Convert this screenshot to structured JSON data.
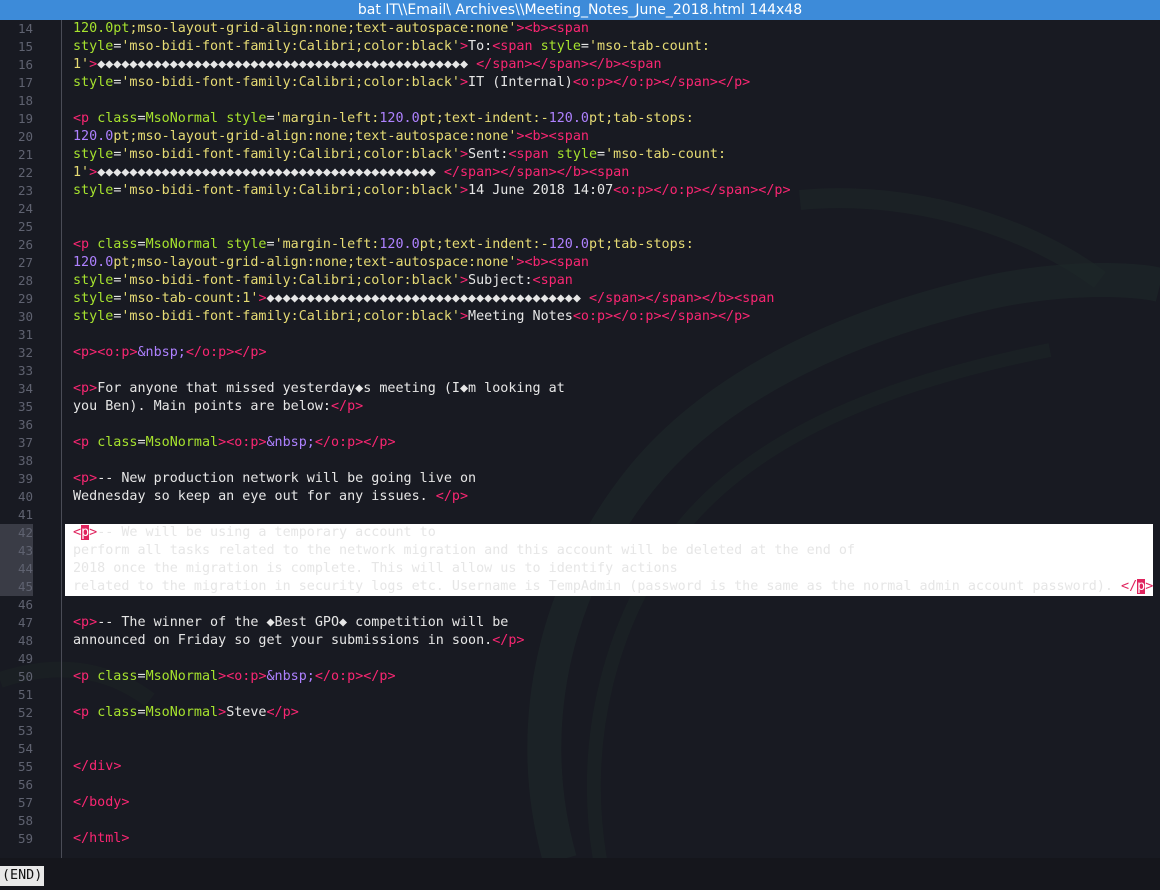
{
  "window": {
    "title": "bat IT\\\\Email\\ Archives\\\\Meeting_Notes_June_2018.html 144x48"
  },
  "colors": {
    "title_bar": "#3d8bd9",
    "background": "#181a22",
    "tag": "#f92672",
    "attribute": "#a6e22e",
    "string": "#e6db74",
    "number": "#ae81ff",
    "selection": "#ffffff"
  },
  "selected_lines": [
    42,
    43,
    44,
    45
  ],
  "lines": [
    {
      "n": "14",
      "tokens": [
        [
          "attr",
          "120.0pt"
        ],
        [
          "str",
          ";mso-layout-grid-align:none;text-autospace:none'"
        ],
        [
          "tag",
          ">"
        ],
        [
          "tag",
          "<b"
        ],
        [
          "tag",
          ">"
        ],
        [
          "tag",
          "<span"
        ]
      ]
    },
    {
      "n": "15",
      "tokens": [
        [
          "attr",
          "style"
        ],
        [
          "txt",
          "="
        ],
        [
          "str",
          "'mso-bidi-font-family:Calibri;color:black'"
        ],
        [
          "tag",
          ">"
        ],
        [
          "txt",
          "To:"
        ],
        [
          "tag",
          "<span"
        ],
        [
          "txt",
          " "
        ],
        [
          "attr",
          "style"
        ],
        [
          "txt",
          "="
        ],
        [
          "str",
          "'mso-tab-count:"
        ]
      ]
    },
    {
      "n": "16",
      "tokens": [
        [
          "str",
          "1'"
        ],
        [
          "tag",
          ">"
        ],
        [
          "txt",
          "◆◆◆◆◆◆◆◆◆◆◆◆◆◆◆◆◆◆◆◆◆◆◆◆◆◆◆◆◆◆◆◆◆◆◆◆◆◆◆◆◆◆◆◆◆◆ "
        ],
        [
          "tag",
          "</span"
        ],
        [
          "tag",
          ">"
        ],
        [
          "tag",
          "</span"
        ],
        [
          "tag",
          ">"
        ],
        [
          "tag",
          "</b"
        ],
        [
          "tag",
          ">"
        ],
        [
          "tag",
          "<span"
        ]
      ]
    },
    {
      "n": "17",
      "tokens": [
        [
          "attr",
          "style"
        ],
        [
          "txt",
          "="
        ],
        [
          "str",
          "'mso-bidi-font-family:Calibri;color:black'"
        ],
        [
          "tag",
          ">"
        ],
        [
          "txt",
          "IT (Internal)"
        ],
        [
          "tag",
          "<o:p"
        ],
        [
          "tag",
          ">"
        ],
        [
          "tag",
          "</o:p"
        ],
        [
          "tag",
          ">"
        ],
        [
          "tag",
          "</span"
        ],
        [
          "tag",
          ">"
        ],
        [
          "tag",
          "</p"
        ],
        [
          "tag",
          ">"
        ]
      ]
    },
    {
      "n": "18",
      "tokens": []
    },
    {
      "n": "19",
      "tokens": [
        [
          "tag",
          "<p"
        ],
        [
          "txt",
          " "
        ],
        [
          "attr",
          "class"
        ],
        [
          "txt",
          "="
        ],
        [
          "attr",
          "MsoNormal"
        ],
        [
          "txt",
          " "
        ],
        [
          "attr",
          "style"
        ],
        [
          "txt",
          "="
        ],
        [
          "str",
          "'margin-left:"
        ],
        [
          "num",
          "120.0"
        ],
        [
          "str",
          "pt;text-indent:-"
        ],
        [
          "num",
          "120.0"
        ],
        [
          "str",
          "pt;tab-stops:"
        ]
      ]
    },
    {
      "n": "20",
      "tokens": [
        [
          "num",
          "120.0"
        ],
        [
          "str",
          "pt;mso-layout-grid-align:none;text-autospace:none'"
        ],
        [
          "tag",
          ">"
        ],
        [
          "tag",
          "<b"
        ],
        [
          "tag",
          ">"
        ],
        [
          "tag",
          "<span"
        ]
      ]
    },
    {
      "n": "21",
      "tokens": [
        [
          "attr",
          "style"
        ],
        [
          "txt",
          "="
        ],
        [
          "str",
          "'mso-bidi-font-family:Calibri;color:black'"
        ],
        [
          "tag",
          ">"
        ],
        [
          "txt",
          "Sent:"
        ],
        [
          "tag",
          "<span"
        ],
        [
          "txt",
          " "
        ],
        [
          "attr",
          "style"
        ],
        [
          "txt",
          "="
        ],
        [
          "str",
          "'mso-tab-count:"
        ]
      ]
    },
    {
      "n": "22",
      "tokens": [
        [
          "str",
          "1'"
        ],
        [
          "tag",
          ">"
        ],
        [
          "txt",
          "◆◆◆◆◆◆◆◆◆◆◆◆◆◆◆◆◆◆◆◆◆◆◆◆◆◆◆◆◆◆◆◆◆◆◆◆◆◆◆◆◆◆ "
        ],
        [
          "tag",
          "</span"
        ],
        [
          "tag",
          ">"
        ],
        [
          "tag",
          "</span"
        ],
        [
          "tag",
          ">"
        ],
        [
          "tag",
          "</b"
        ],
        [
          "tag",
          ">"
        ],
        [
          "tag",
          "<span"
        ]
      ]
    },
    {
      "n": "23",
      "tokens": [
        [
          "attr",
          "style"
        ],
        [
          "txt",
          "="
        ],
        [
          "str",
          "'mso-bidi-font-family:Calibri;color:black'"
        ],
        [
          "tag",
          ">"
        ],
        [
          "txt",
          "14 June 2018 14:07"
        ],
        [
          "tag",
          "<o:p"
        ],
        [
          "tag",
          ">"
        ],
        [
          "tag",
          "</o:p"
        ],
        [
          "tag",
          ">"
        ],
        [
          "tag",
          "</span"
        ],
        [
          "tag",
          ">"
        ],
        [
          "tag",
          "</p"
        ],
        [
          "tag",
          ">"
        ]
      ]
    },
    {
      "n": "24",
      "tokens": []
    },
    {
      "n": "25",
      "tokens": []
    },
    {
      "n": "26",
      "tokens": [
        [
          "tag",
          "<p"
        ],
        [
          "txt",
          " "
        ],
        [
          "attr",
          "class"
        ],
        [
          "txt",
          "="
        ],
        [
          "attr",
          "MsoNormal"
        ],
        [
          "txt",
          " "
        ],
        [
          "attr",
          "style"
        ],
        [
          "txt",
          "="
        ],
        [
          "str",
          "'margin-left:"
        ],
        [
          "num",
          "120.0"
        ],
        [
          "str",
          "pt;text-indent:-"
        ],
        [
          "num",
          "120.0"
        ],
        [
          "str",
          "pt;tab-stops:"
        ]
      ]
    },
    {
      "n": "27",
      "tokens": [
        [
          "num",
          "120.0"
        ],
        [
          "str",
          "pt;mso-layout-grid-align:none;text-autospace:none'"
        ],
        [
          "tag",
          ">"
        ],
        [
          "tag",
          "<b"
        ],
        [
          "tag",
          ">"
        ],
        [
          "tag",
          "<span"
        ]
      ]
    },
    {
      "n": "28",
      "tokens": [
        [
          "attr",
          "style"
        ],
        [
          "txt",
          "="
        ],
        [
          "str",
          "'mso-bidi-font-family:Calibri;color:black'"
        ],
        [
          "tag",
          ">"
        ],
        [
          "txt",
          "Subject:"
        ],
        [
          "tag",
          "<span"
        ]
      ]
    },
    {
      "n": "29",
      "tokens": [
        [
          "attr",
          "style"
        ],
        [
          "txt",
          "="
        ],
        [
          "str",
          "'mso-tab-count:1'"
        ],
        [
          "tag",
          ">"
        ],
        [
          "txt",
          "◆◆◆◆◆◆◆◆◆◆◆◆◆◆◆◆◆◆◆◆◆◆◆◆◆◆◆◆◆◆◆◆◆◆◆◆◆◆◆ "
        ],
        [
          "tag",
          "</span"
        ],
        [
          "tag",
          ">"
        ],
        [
          "tag",
          "</span"
        ],
        [
          "tag",
          ">"
        ],
        [
          "tag",
          "</b"
        ],
        [
          "tag",
          ">"
        ],
        [
          "tag",
          "<span"
        ]
      ]
    },
    {
      "n": "30",
      "tokens": [
        [
          "attr",
          "style"
        ],
        [
          "txt",
          "="
        ],
        [
          "str",
          "'mso-bidi-font-family:Calibri;color:black'"
        ],
        [
          "tag",
          ">"
        ],
        [
          "txt",
          "Meeting Notes"
        ],
        [
          "tag",
          "<o:p"
        ],
        [
          "tag",
          ">"
        ],
        [
          "tag",
          "</o:p"
        ],
        [
          "tag",
          ">"
        ],
        [
          "tag",
          "</span"
        ],
        [
          "tag",
          ">"
        ],
        [
          "tag",
          "</p"
        ],
        [
          "tag",
          ">"
        ]
      ]
    },
    {
      "n": "31",
      "tokens": []
    },
    {
      "n": "32",
      "tokens": [
        [
          "tag",
          "<p"
        ],
        [
          "tag",
          ">"
        ],
        [
          "tag",
          "<o:p"
        ],
        [
          "tag",
          ">"
        ],
        [
          "ent",
          "&nbsp;"
        ],
        [
          "tag",
          "</o:p"
        ],
        [
          "tag",
          ">"
        ],
        [
          "tag",
          "</p"
        ],
        [
          "tag",
          ">"
        ]
      ]
    },
    {
      "n": "33",
      "tokens": []
    },
    {
      "n": "34",
      "tokens": [
        [
          "tag",
          "<p"
        ],
        [
          "tag",
          ">"
        ],
        [
          "txt",
          "For anyone that missed yesterday◆s meeting (I◆m looking at"
        ]
      ]
    },
    {
      "n": "35",
      "tokens": [
        [
          "txt",
          "you Ben). Main points are below:"
        ],
        [
          "tag",
          "</p"
        ],
        [
          "tag",
          ">"
        ]
      ]
    },
    {
      "n": "36",
      "tokens": []
    },
    {
      "n": "37",
      "tokens": [
        [
          "tag",
          "<p"
        ],
        [
          "txt",
          " "
        ],
        [
          "attr",
          "class"
        ],
        [
          "txt",
          "="
        ],
        [
          "attr",
          "MsoNormal"
        ],
        [
          "tag",
          ">"
        ],
        [
          "tag",
          "<o:p"
        ],
        [
          "tag",
          ">"
        ],
        [
          "ent",
          "&nbsp;"
        ],
        [
          "tag",
          "</o:p"
        ],
        [
          "tag",
          ">"
        ],
        [
          "tag",
          "</p"
        ],
        [
          "tag",
          ">"
        ]
      ]
    },
    {
      "n": "38",
      "tokens": []
    },
    {
      "n": "39",
      "tokens": [
        [
          "tag",
          "<p"
        ],
        [
          "tag",
          ">"
        ],
        [
          "txt",
          "-- New production network will be going live on"
        ]
      ]
    },
    {
      "n": "40",
      "tokens": [
        [
          "txt",
          "Wednesday so keep an eye out for any issues. "
        ],
        [
          "tag",
          "</p"
        ],
        [
          "tag",
          ">"
        ]
      ]
    },
    {
      "n": "41",
      "tokens": []
    },
    {
      "n": "42",
      "tokens": [
        [
          "tag",
          "<"
        ],
        [
          "cur",
          "p"
        ],
        [
          "tag",
          ">"
        ],
        [
          "txt",
          "-- We will be using a temporary account to"
        ]
      ]
    },
    {
      "n": "43",
      "tokens": [
        [
          "txt",
          "perform all tasks related to the network migration and this account will be deleted at the end of"
        ]
      ]
    },
    {
      "n": "44",
      "tokens": [
        [
          "txt",
          "2018 once the migration is complete. This will allow us to identify actions"
        ]
      ]
    },
    {
      "n": "45",
      "tokens": [
        [
          "txt",
          "related to the migration in security logs etc. Username is TempAdmin (password is the same as the normal admin account password). "
        ],
        [
          "tag",
          "</"
        ],
        [
          "cur",
          "p"
        ],
        [
          "tag",
          ">"
        ]
      ]
    },
    {
      "n": "46",
      "tokens": []
    },
    {
      "n": "47",
      "tokens": [
        [
          "tag",
          "<p"
        ],
        [
          "tag",
          ">"
        ],
        [
          "txt",
          "-- The winner of the ◆Best GPO◆ competition will be"
        ]
      ]
    },
    {
      "n": "48",
      "tokens": [
        [
          "txt",
          "announced on Friday so get your submissions in soon."
        ],
        [
          "tag",
          "</p"
        ],
        [
          "tag",
          ">"
        ]
      ]
    },
    {
      "n": "49",
      "tokens": []
    },
    {
      "n": "50",
      "tokens": [
        [
          "tag",
          "<p"
        ],
        [
          "txt",
          " "
        ],
        [
          "attr",
          "class"
        ],
        [
          "txt",
          "="
        ],
        [
          "attr",
          "MsoNormal"
        ],
        [
          "tag",
          ">"
        ],
        [
          "tag",
          "<o:p"
        ],
        [
          "tag",
          ">"
        ],
        [
          "ent",
          "&nbsp;"
        ],
        [
          "tag",
          "</o:p"
        ],
        [
          "tag",
          ">"
        ],
        [
          "tag",
          "</p"
        ],
        [
          "tag",
          ">"
        ]
      ]
    },
    {
      "n": "51",
      "tokens": []
    },
    {
      "n": "52",
      "tokens": [
        [
          "tag",
          "<p"
        ],
        [
          "txt",
          " "
        ],
        [
          "attr",
          "class"
        ],
        [
          "txt",
          "="
        ],
        [
          "attr",
          "MsoNormal"
        ],
        [
          "tag",
          ">"
        ],
        [
          "txt",
          "Steve"
        ],
        [
          "tag",
          "</p"
        ],
        [
          "tag",
          ">"
        ]
      ]
    },
    {
      "n": "53",
      "tokens": []
    },
    {
      "n": "54",
      "tokens": []
    },
    {
      "n": "55",
      "tokens": [
        [
          "tag",
          "</div"
        ],
        [
          "tag",
          ">"
        ]
      ]
    },
    {
      "n": "56",
      "tokens": []
    },
    {
      "n": "57",
      "tokens": [
        [
          "tag",
          "</body"
        ],
        [
          "tag",
          ">"
        ]
      ]
    },
    {
      "n": "58",
      "tokens": []
    },
    {
      "n": "59",
      "tokens": [
        [
          "tag",
          "</html"
        ],
        [
          "tag",
          ">"
        ]
      ]
    }
  ],
  "status": {
    "end_label": "(END)"
  }
}
